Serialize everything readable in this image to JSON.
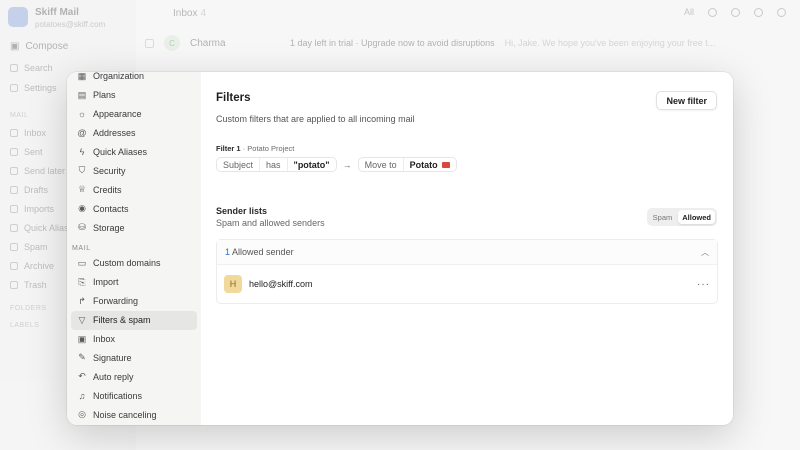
{
  "background": {
    "brand_name": "Skiff Mail",
    "brand_sub": "potatoes@skiff.com",
    "compose": "Compose",
    "top_nav": [
      "Search",
      "Settings"
    ],
    "section_mail": "MAIL",
    "mail_items": [
      "Inbox",
      "Sent",
      "Send later",
      "Drafts",
      "Imports",
      "Quick Aliases",
      "Spam",
      "Archive",
      "Trash"
    ],
    "section_folders": "FOLDERS",
    "section_labels": "LABELS",
    "header_title": "Inbox",
    "header_count": "4",
    "header_filter": "All",
    "rows": [
      {
        "avatar": "C",
        "from": "Charma",
        "subject": "1 day left in trial · Upgrade now to avoid disruptions",
        "preview": "Hi, Jake. We hope you've been enjoying your free t..."
      },
      {
        "avatar": "",
        "from": "",
        "subject": "",
        "preview": ""
      }
    ]
  },
  "sidebar": {
    "items_top": [
      {
        "label": "Organization",
        "icon": "building-icon",
        "glyph": "▦"
      },
      {
        "label": "Plans",
        "icon": "book-icon",
        "glyph": "▤"
      },
      {
        "label": "Appearance",
        "icon": "sun-icon",
        "glyph": "☼"
      },
      {
        "label": "Addresses",
        "icon": "at-icon",
        "glyph": "@"
      },
      {
        "label": "Quick Aliases",
        "icon": "bolt-icon",
        "glyph": "ϟ"
      },
      {
        "label": "Security",
        "icon": "shield-icon",
        "glyph": "⛉"
      },
      {
        "label": "Credits",
        "icon": "trophy-icon",
        "glyph": "♕"
      },
      {
        "label": "Contacts",
        "icon": "user-circle-icon",
        "glyph": "◉"
      },
      {
        "label": "Storage",
        "icon": "database-icon",
        "glyph": "⛁"
      }
    ],
    "section_mail": "MAIL",
    "items_mail": [
      {
        "label": "Custom domains",
        "icon": "domain-icon",
        "glyph": "▭"
      },
      {
        "label": "Import",
        "icon": "import-icon",
        "glyph": "⎘"
      },
      {
        "label": "Forwarding",
        "icon": "forward-icon",
        "glyph": "↱"
      },
      {
        "label": "Filters & spam",
        "icon": "filter-icon",
        "glyph": "▽",
        "active": true
      },
      {
        "label": "Inbox",
        "icon": "inbox-icon",
        "glyph": "▣"
      },
      {
        "label": "Signature",
        "icon": "pen-icon",
        "glyph": "✎"
      },
      {
        "label": "Auto reply",
        "icon": "reply-icon",
        "glyph": "↶"
      },
      {
        "label": "Notifications",
        "icon": "bell-icon",
        "glyph": "♫"
      },
      {
        "label": "Noise canceling",
        "icon": "noise-icon",
        "glyph": "◎"
      }
    ]
  },
  "filters": {
    "title": "Filters",
    "new_button": "New filter",
    "description": "Custom filters that are applied to all incoming mail",
    "filter1": {
      "name": "Filter 1",
      "separator": " · ",
      "folder_name": "Potato Project",
      "field": "Subject",
      "operator": "has",
      "value": "\"potato\"",
      "arrow": "→",
      "action": "Move to",
      "target": "Potato",
      "target_color": "#d9483b"
    }
  },
  "sender_lists": {
    "title": "Sender lists",
    "subtitle": "Spam and allowed senders",
    "toggle": [
      "Spam",
      "Allowed"
    ],
    "active_toggle": "Allowed",
    "count": "1",
    "count_label": "Allowed sender",
    "senders": [
      {
        "initial": "H",
        "email": "hello@skiff.com",
        "menu": "···"
      }
    ]
  }
}
